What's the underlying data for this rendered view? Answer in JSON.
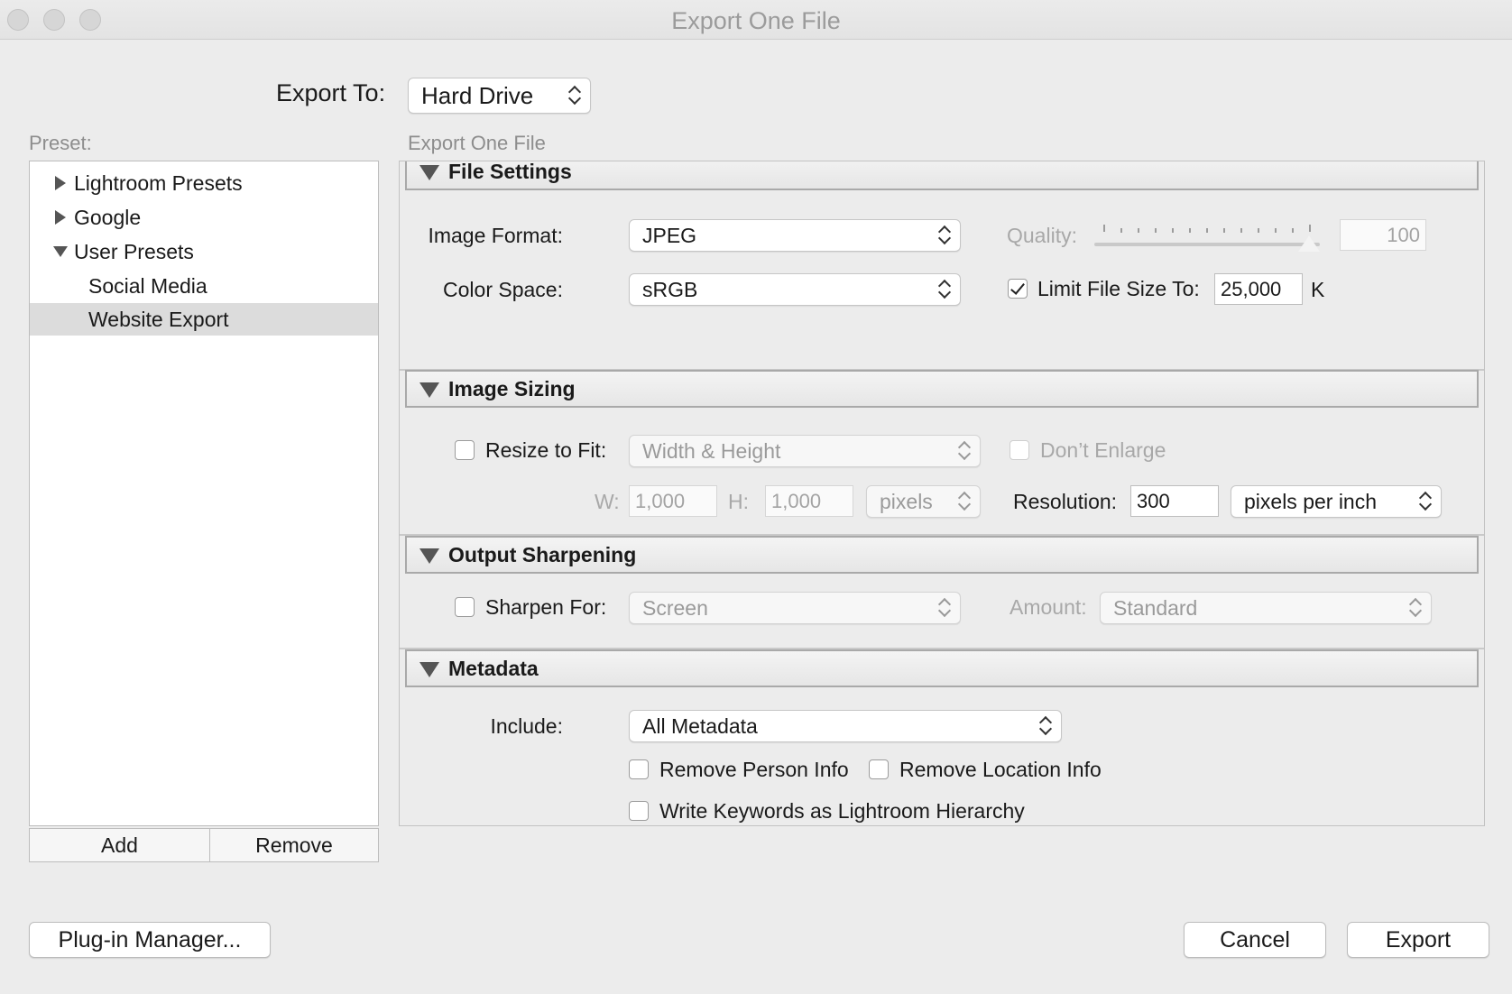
{
  "window": {
    "title": "Export One File"
  },
  "export_to": {
    "label": "Export To:",
    "value": "Hard Drive"
  },
  "preset": {
    "label": "Preset:",
    "items": [
      {
        "label": "Lightroom Presets"
      },
      {
        "label": "Google"
      },
      {
        "label": "User Presets"
      },
      {
        "label": "Social Media"
      },
      {
        "label": "Website Export"
      }
    ],
    "add_label": "Add",
    "remove_label": "Remove"
  },
  "settings": {
    "header": "Export One File",
    "file_settings": {
      "title": "File Settings",
      "image_format_label": "Image Format:",
      "image_format": "JPEG",
      "quality_label": "Quality:",
      "quality_value": "100",
      "quality_level": 1.0,
      "color_space_label": "Color Space:",
      "color_space": "sRGB",
      "limit_size_label": "Limit File Size To:",
      "limit_size_checked": true,
      "limit_size_value": "25,000",
      "limit_size_unit": "K"
    },
    "image_sizing": {
      "title": "Image Sizing",
      "resize_label": "Resize to Fit:",
      "resize_checked": false,
      "resize_mode": "Width & Height",
      "dont_enlarge_label": "Don’t Enlarge",
      "w_label": "W:",
      "w_value": "1,000",
      "h_label": "H:",
      "h_value": "1,000",
      "size_unit": "pixels",
      "resolution_label": "Resolution:",
      "resolution_value": "300",
      "resolution_unit": "pixels per inch"
    },
    "output_sharpening": {
      "title": "Output Sharpening",
      "sharpen_label": "Sharpen For:",
      "sharpen_checked": false,
      "sharpen_for": "Screen",
      "amount_label": "Amount:",
      "amount": "Standard"
    },
    "metadata": {
      "title": "Metadata",
      "include_label": "Include:",
      "include": "All Metadata",
      "remove_person_label": "Remove Person Info",
      "remove_location_label": "Remove Location Info",
      "write_keywords_label": "Write Keywords as Lightroom Hierarchy"
    }
  },
  "footer": {
    "plugin_manager_label": "Plug-in Manager...",
    "cancel_label": "Cancel",
    "export_label": "Export"
  }
}
